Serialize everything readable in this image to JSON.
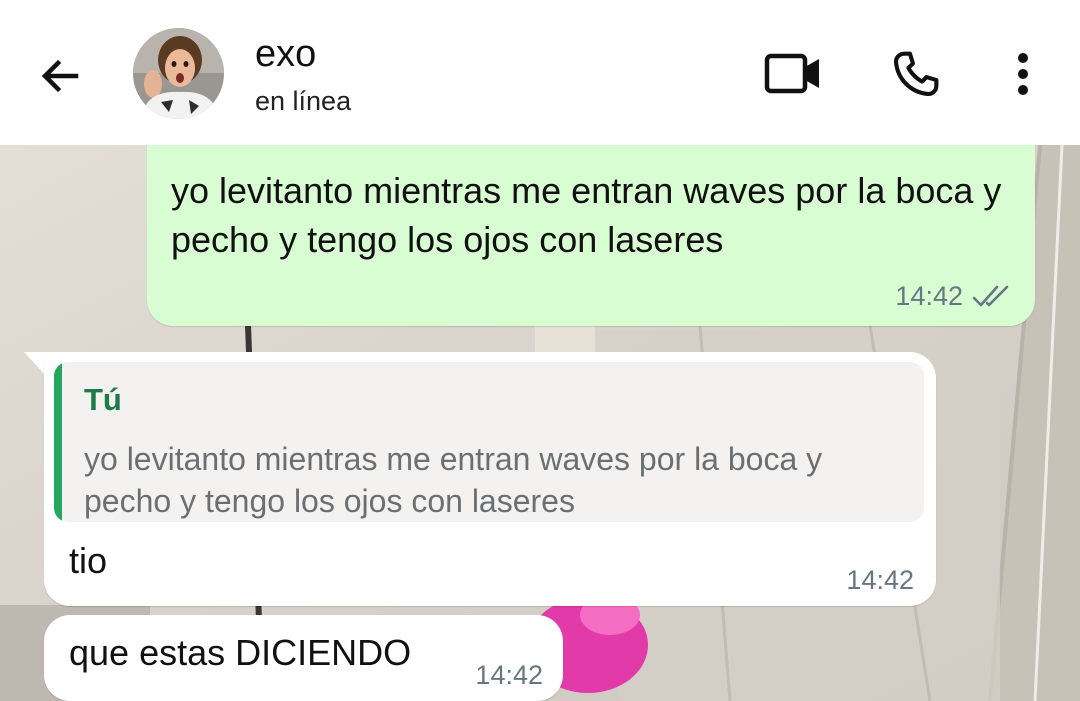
{
  "header": {
    "contact_name": "exo",
    "status": "en línea",
    "icons": [
      "arrow-left-icon",
      "video-camera-icon",
      "phone-icon",
      "more-vertical-icon"
    ]
  },
  "messages": [
    {
      "direction": "outgoing",
      "text": "yo levitanto mientras me entran waves por la boca y pecho y tengo los ojos con laseres",
      "time": "14:42",
      "status": "read"
    },
    {
      "direction": "incoming",
      "quote": {
        "author": "Tú",
        "text": "yo levitanto mientras me entran waves por la boca y pecho y tengo los ojos con laseres"
      },
      "text": "tio",
      "time": "14:42"
    },
    {
      "direction": "incoming",
      "text": "que estas DICIENDO",
      "time": "14:42"
    }
  ],
  "colors": {
    "outgoing_bubble": "#d9fdd3",
    "incoming_bubble": "#ffffff",
    "quote_bar": "#25a55f",
    "quote_author": "#1f7a4a",
    "timestamp": "#667781"
  }
}
